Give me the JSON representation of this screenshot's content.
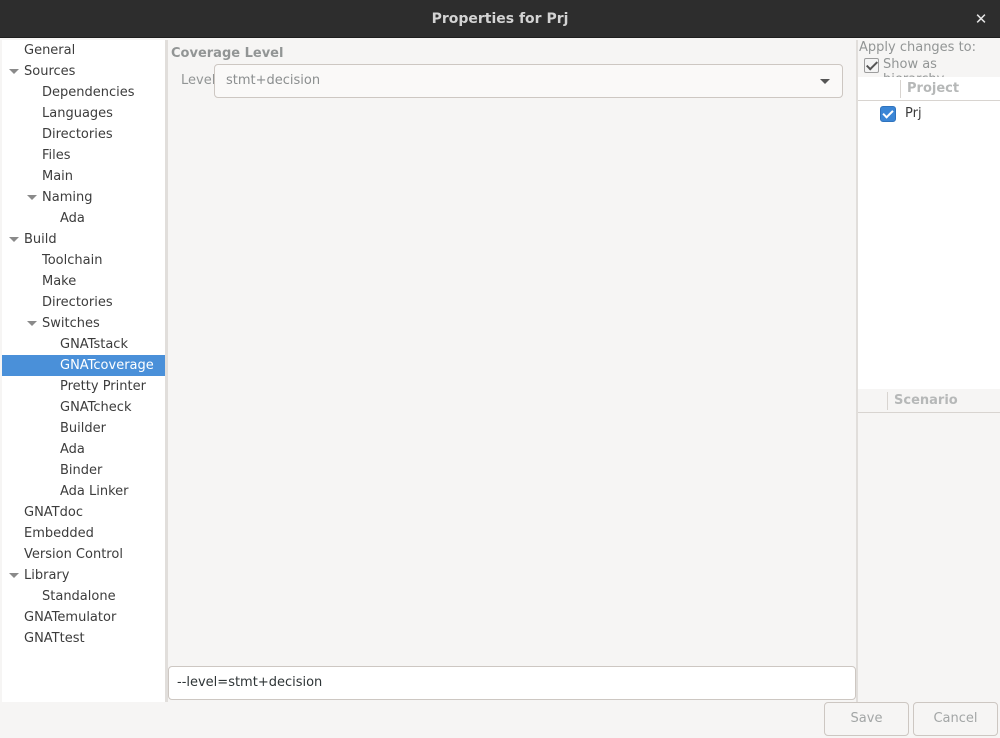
{
  "window": {
    "title": "Properties for Prj",
    "close_glyph": "✕"
  },
  "tree": {
    "items": [
      {
        "label": "General",
        "depth": 0,
        "expander": false,
        "selected": false
      },
      {
        "label": "Sources",
        "depth": 0,
        "expander": true,
        "selected": false
      },
      {
        "label": "Dependencies",
        "depth": 1,
        "expander": false,
        "selected": false
      },
      {
        "label": "Languages",
        "depth": 1,
        "expander": false,
        "selected": false
      },
      {
        "label": "Directories",
        "depth": 1,
        "expander": false,
        "selected": false
      },
      {
        "label": "Files",
        "depth": 1,
        "expander": false,
        "selected": false
      },
      {
        "label": "Main",
        "depth": 1,
        "expander": false,
        "selected": false
      },
      {
        "label": "Naming",
        "depth": 1,
        "expander": true,
        "selected": false
      },
      {
        "label": "Ada",
        "depth": 2,
        "expander": false,
        "selected": false
      },
      {
        "label": "Build",
        "depth": 0,
        "expander": true,
        "selected": false
      },
      {
        "label": "Toolchain",
        "depth": 1,
        "expander": false,
        "selected": false
      },
      {
        "label": "Make",
        "depth": 1,
        "expander": false,
        "selected": false
      },
      {
        "label": "Directories",
        "depth": 1,
        "expander": false,
        "selected": false
      },
      {
        "label": "Switches",
        "depth": 1,
        "expander": true,
        "selected": false
      },
      {
        "label": "GNATstack",
        "depth": 2,
        "expander": false,
        "selected": false
      },
      {
        "label": "GNATcoverage",
        "depth": 2,
        "expander": false,
        "selected": true
      },
      {
        "label": "Pretty Printer",
        "depth": 2,
        "expander": false,
        "selected": false
      },
      {
        "label": "GNATcheck",
        "depth": 2,
        "expander": false,
        "selected": false
      },
      {
        "label": "Builder",
        "depth": 2,
        "expander": false,
        "selected": false
      },
      {
        "label": "Ada",
        "depth": 2,
        "expander": false,
        "selected": false
      },
      {
        "label": "Binder",
        "depth": 2,
        "expander": false,
        "selected": false
      },
      {
        "label": "Ada Linker",
        "depth": 2,
        "expander": false,
        "selected": false
      },
      {
        "label": "GNATdoc",
        "depth": 0,
        "expander": false,
        "selected": false
      },
      {
        "label": "Embedded",
        "depth": 0,
        "expander": false,
        "selected": false
      },
      {
        "label": "Version Control",
        "depth": 0,
        "expander": false,
        "selected": false
      },
      {
        "label": "Library",
        "depth": 0,
        "expander": true,
        "selected": false
      },
      {
        "label": "Standalone",
        "depth": 1,
        "expander": false,
        "selected": false
      },
      {
        "label": "GNATemulator",
        "depth": 0,
        "expander": false,
        "selected": false
      },
      {
        "label": "GNATtest",
        "depth": 0,
        "expander": false,
        "selected": false
      }
    ]
  },
  "center": {
    "section_title": "Coverage Level",
    "level_label": "Level",
    "level_value": "stmt+decision",
    "command_line": "--level=stmt+decision"
  },
  "right": {
    "apply_label": "Apply changes to:",
    "show_hierarchy_label": "Show as hierarchy",
    "show_hierarchy_checked": true,
    "project_header": "Project",
    "project_name": "Prj",
    "project_checked": true,
    "scenario_header": "Scenario"
  },
  "buttons": {
    "save": "Save",
    "cancel": "Cancel"
  },
  "colors": {
    "selection": "#4a90d9",
    "titlebar": "#2d2d2d",
    "checkbox_accent": "#3b86d6"
  }
}
